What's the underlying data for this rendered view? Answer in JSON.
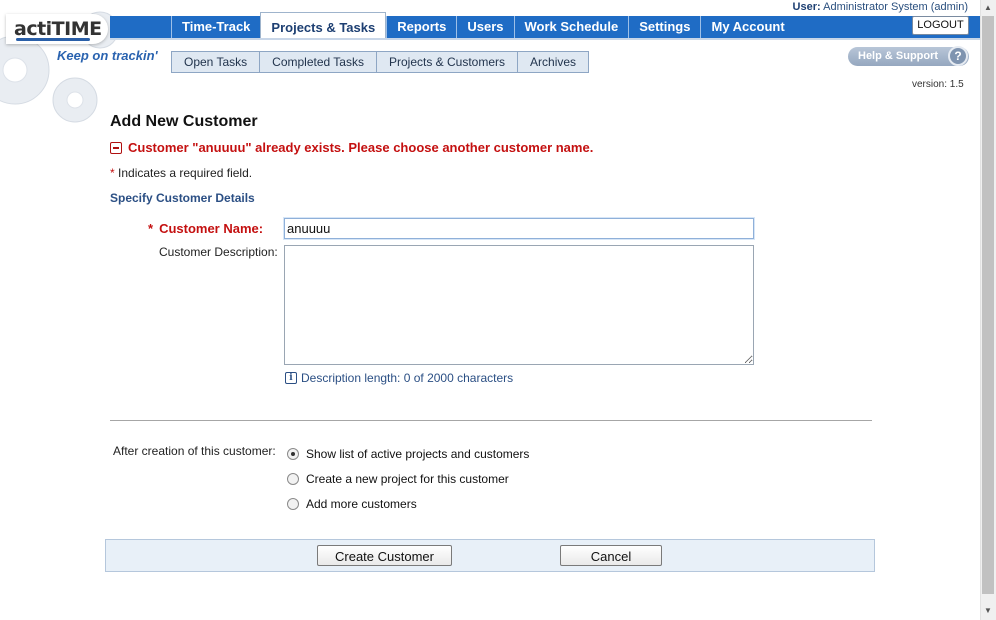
{
  "branding": {
    "logo_text": "actiTIME",
    "tagline": "Keep on trackin'"
  },
  "header": {
    "user_label": "User:",
    "user_name": "Administrator System (admin)",
    "logout_label": "LOGOUT",
    "help_label": "Help & Support",
    "help_icon_glyph": "?",
    "version": "version: 1.5"
  },
  "nav": {
    "tabs": [
      {
        "label": "Time-Track"
      },
      {
        "label": "Projects & Tasks",
        "active": true
      },
      {
        "label": "Reports"
      },
      {
        "label": "Users"
      },
      {
        "label": "Work Schedule"
      },
      {
        "label": "Settings"
      },
      {
        "label": "My Account"
      }
    ],
    "subtabs": [
      {
        "label": "Open Tasks"
      },
      {
        "label": "Completed Tasks"
      },
      {
        "label": "Projects & Customers"
      },
      {
        "label": "Archives"
      }
    ]
  },
  "form": {
    "title": "Add New Customer",
    "error_message": "Customer \"anuuuu\" already exists. Please choose another customer name.",
    "required_star": "*",
    "required_note": " Indicates a required field.",
    "section_title": "Specify Customer Details",
    "name_label": "Customer Name:",
    "name_value": "anuuuu",
    "description_label": "Customer Description:",
    "description_value": "",
    "info_icon_glyph": "i",
    "description_info": "Description length: 0 of 2000 characters",
    "after_label": "After creation of this customer:",
    "options": [
      {
        "label": "Show list of active projects and customers",
        "checked": true
      },
      {
        "label": "Create a new project for this customer",
        "checked": false
      },
      {
        "label": "Add more customers",
        "checked": false
      }
    ],
    "create_button": "Create Customer",
    "cancel_button": "Cancel"
  },
  "colors": {
    "nav_blue": "#1f6cc5",
    "error_red": "#c41010",
    "section_blue": "#2b4f84",
    "action_bar_bg": "#e8f0f8"
  }
}
